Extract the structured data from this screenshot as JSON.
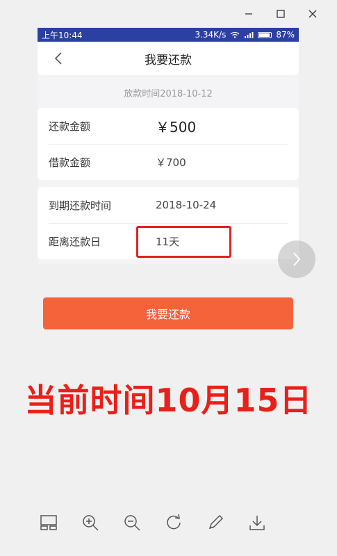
{
  "status_bar": {
    "time": "上午10:44",
    "net_speed": "3.34K/s",
    "battery": "87%"
  },
  "app_bar": {
    "title": "我要还款"
  },
  "loan_date": "放款时间2018-10-12",
  "amounts": {
    "repay_label": "还款金额",
    "repay_value": "￥500",
    "borrow_label": "借款金额",
    "borrow_value": "￥700"
  },
  "due": {
    "due_label": "到期还款时间",
    "due_value": "2018-10-24",
    "remaining_label": "距离还款日",
    "remaining_value": "11天"
  },
  "repay_button": "我要还款",
  "annotation": "当前时间10月15日",
  "colors": {
    "status_bar": "#2c3fa3",
    "button": "#f4633a",
    "highlight": "#e22222",
    "annotation": "#e8201a"
  },
  "toolbar": [
    "window-layout-icon",
    "zoom-in-icon",
    "zoom-out-icon",
    "rotate-icon",
    "edit-icon",
    "download-icon"
  ]
}
